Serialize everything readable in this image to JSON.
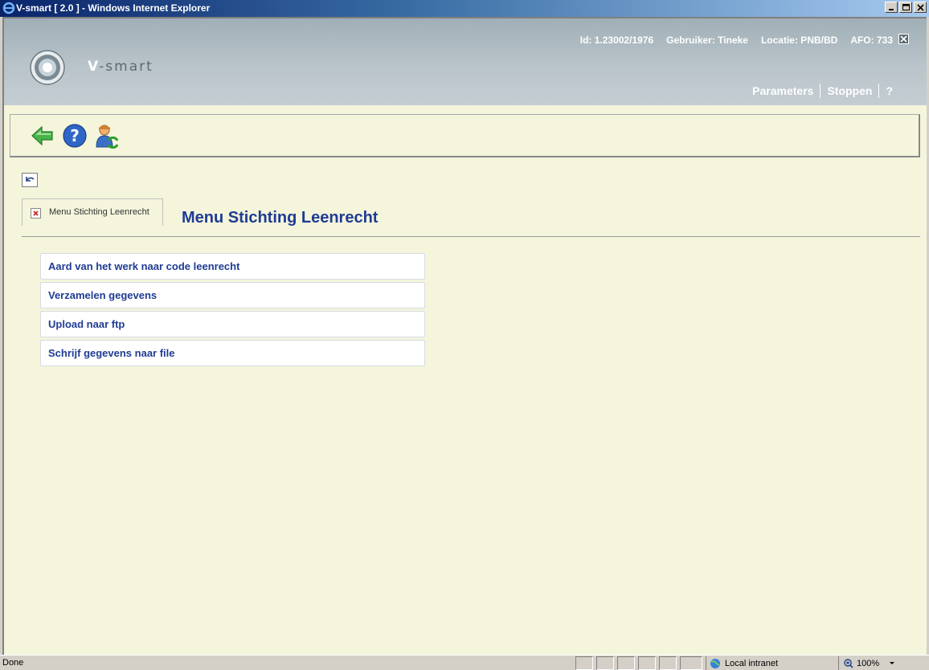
{
  "window": {
    "title": "V-smart [ 2.0 ] - Windows Internet Explorer"
  },
  "header": {
    "logo_prefix": "V",
    "logo_rest": "-smart",
    "id": "Id: 1.23002/1976",
    "user": "Gebruiker: Tineke",
    "location": "Locatie: PNB/BD",
    "afo": "AFO: 733",
    "links": {
      "parameters": "Parameters",
      "stop": "Stoppen",
      "help": "?"
    }
  },
  "tab": {
    "label": "Menu Stichting Leenrecht"
  },
  "page": {
    "title": "Menu Stichting Leenrecht"
  },
  "menu": [
    {
      "label": "Aard van het werk naar code leenrecht"
    },
    {
      "label": "Verzamelen gegevens"
    },
    {
      "label": "Upload naar ftp"
    },
    {
      "label": "Schrijf gegevens naar file"
    }
  ],
  "statusbar": {
    "status": "Done",
    "zone": "Local intranet",
    "zoom": "100%"
  },
  "colors": {
    "accent": "#1f3c93",
    "background": "#f5f5dc",
    "header": "#b9c4ca"
  }
}
